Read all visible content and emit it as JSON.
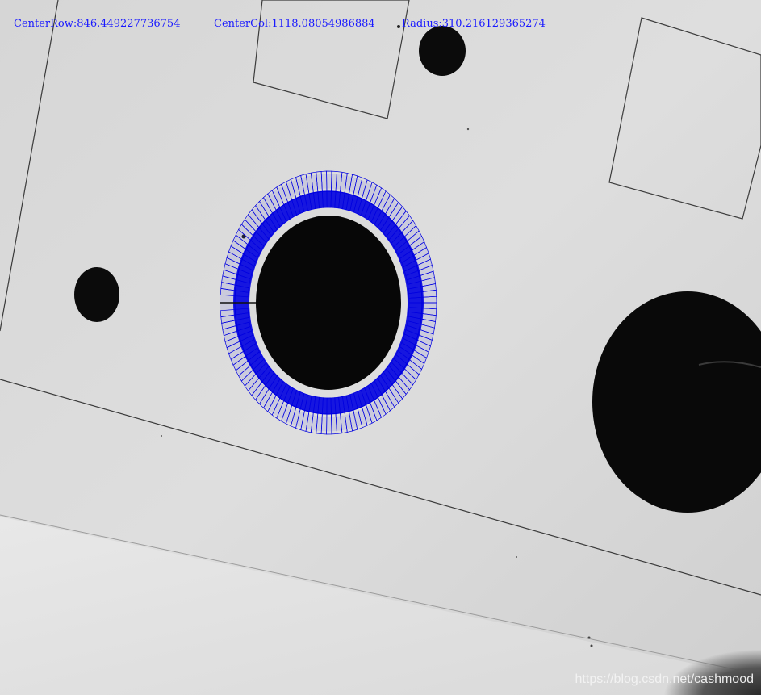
{
  "measurement": {
    "center_row_label": "CenterRow:",
    "center_row_value": "846.449227736754",
    "center_col_label": "CenterCol:",
    "center_col_value": "1118.08054986884",
    "radius_label": "Radius:",
    "radius_value": "310.216129365274"
  },
  "watermark": {
    "text": "https://blog.csdn.net/cashmood"
  },
  "colors": {
    "overlay": "#0000e0",
    "readout_text": "#1a1aff",
    "part_surface": "#dcdcdc",
    "hole_fill": "#070707"
  }
}
